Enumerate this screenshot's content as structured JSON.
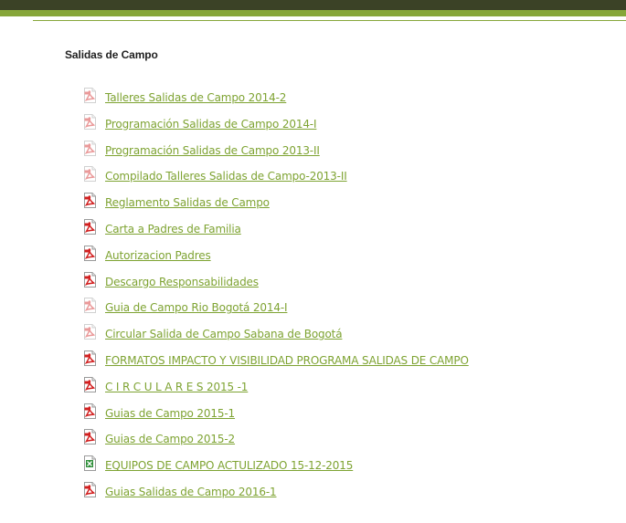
{
  "section": {
    "title": "Salidas de Campo"
  },
  "documents": [
    {
      "label": "Talleres Salidas de Campo 2014-2",
      "icon": "pdf-icon",
      "faded": true
    },
    {
      "label": "Programación Salidas de Campo 2014-I",
      "icon": "pdf-icon",
      "faded": true
    },
    {
      "label": "Programación Salidas de Campo 2013-II",
      "icon": "pdf-icon",
      "faded": true
    },
    {
      "label": "Compilado Talleres Salidas de Campo-2013-II",
      "icon": "pdf-icon",
      "faded": true
    },
    {
      "label": "Reglamento Salidas de Campo",
      "icon": "pdf-icon",
      "faded": false
    },
    {
      "label": "Carta a Padres de Familia",
      "icon": "pdf-icon",
      "faded": false
    },
    {
      "label": "Autorizacion Padres",
      "icon": "pdf-icon",
      "faded": false
    },
    {
      "label": "Descargo Responsabilidades",
      "icon": "pdf-icon",
      "faded": false
    },
    {
      "label": "Guia de Campo Rio Bogotá 2014-I",
      "icon": "pdf-icon",
      "faded": true
    },
    {
      "label": "Circular Salida de Campo Sabana de Bogotá",
      "icon": "pdf-icon",
      "faded": true
    },
    {
      "label": "FORMATOS IMPACTO Y VISIBILIDAD PROGRAMA SALIDAS DE CAMPO",
      "icon": "pdf-icon",
      "faded": false
    },
    {
      "label": "C I R C U L A R E S 2015 -1",
      "icon": "pdf-icon",
      "faded": false
    },
    {
      "label": "Guias de Campo 2015-1",
      "icon": "pdf-icon",
      "faded": false
    },
    {
      "label": "Guias de Campo 2015-2",
      "icon": "pdf-icon",
      "faded": false
    },
    {
      "label": "EQUIPOS DE CAMPO ACTULIZADO 15-12-2015",
      "icon": "excel-icon",
      "faded": false
    },
    {
      "label": "Guias Salidas de Campo 2016-1",
      "icon": "pdf-icon",
      "faded": false
    }
  ],
  "colors": {
    "top_bar": "#3b4226",
    "accent_green": "#86a63a",
    "link_green": "#7ea332",
    "pdf_red": "#d21f1f",
    "excel_green": "#2f8f3a"
  }
}
